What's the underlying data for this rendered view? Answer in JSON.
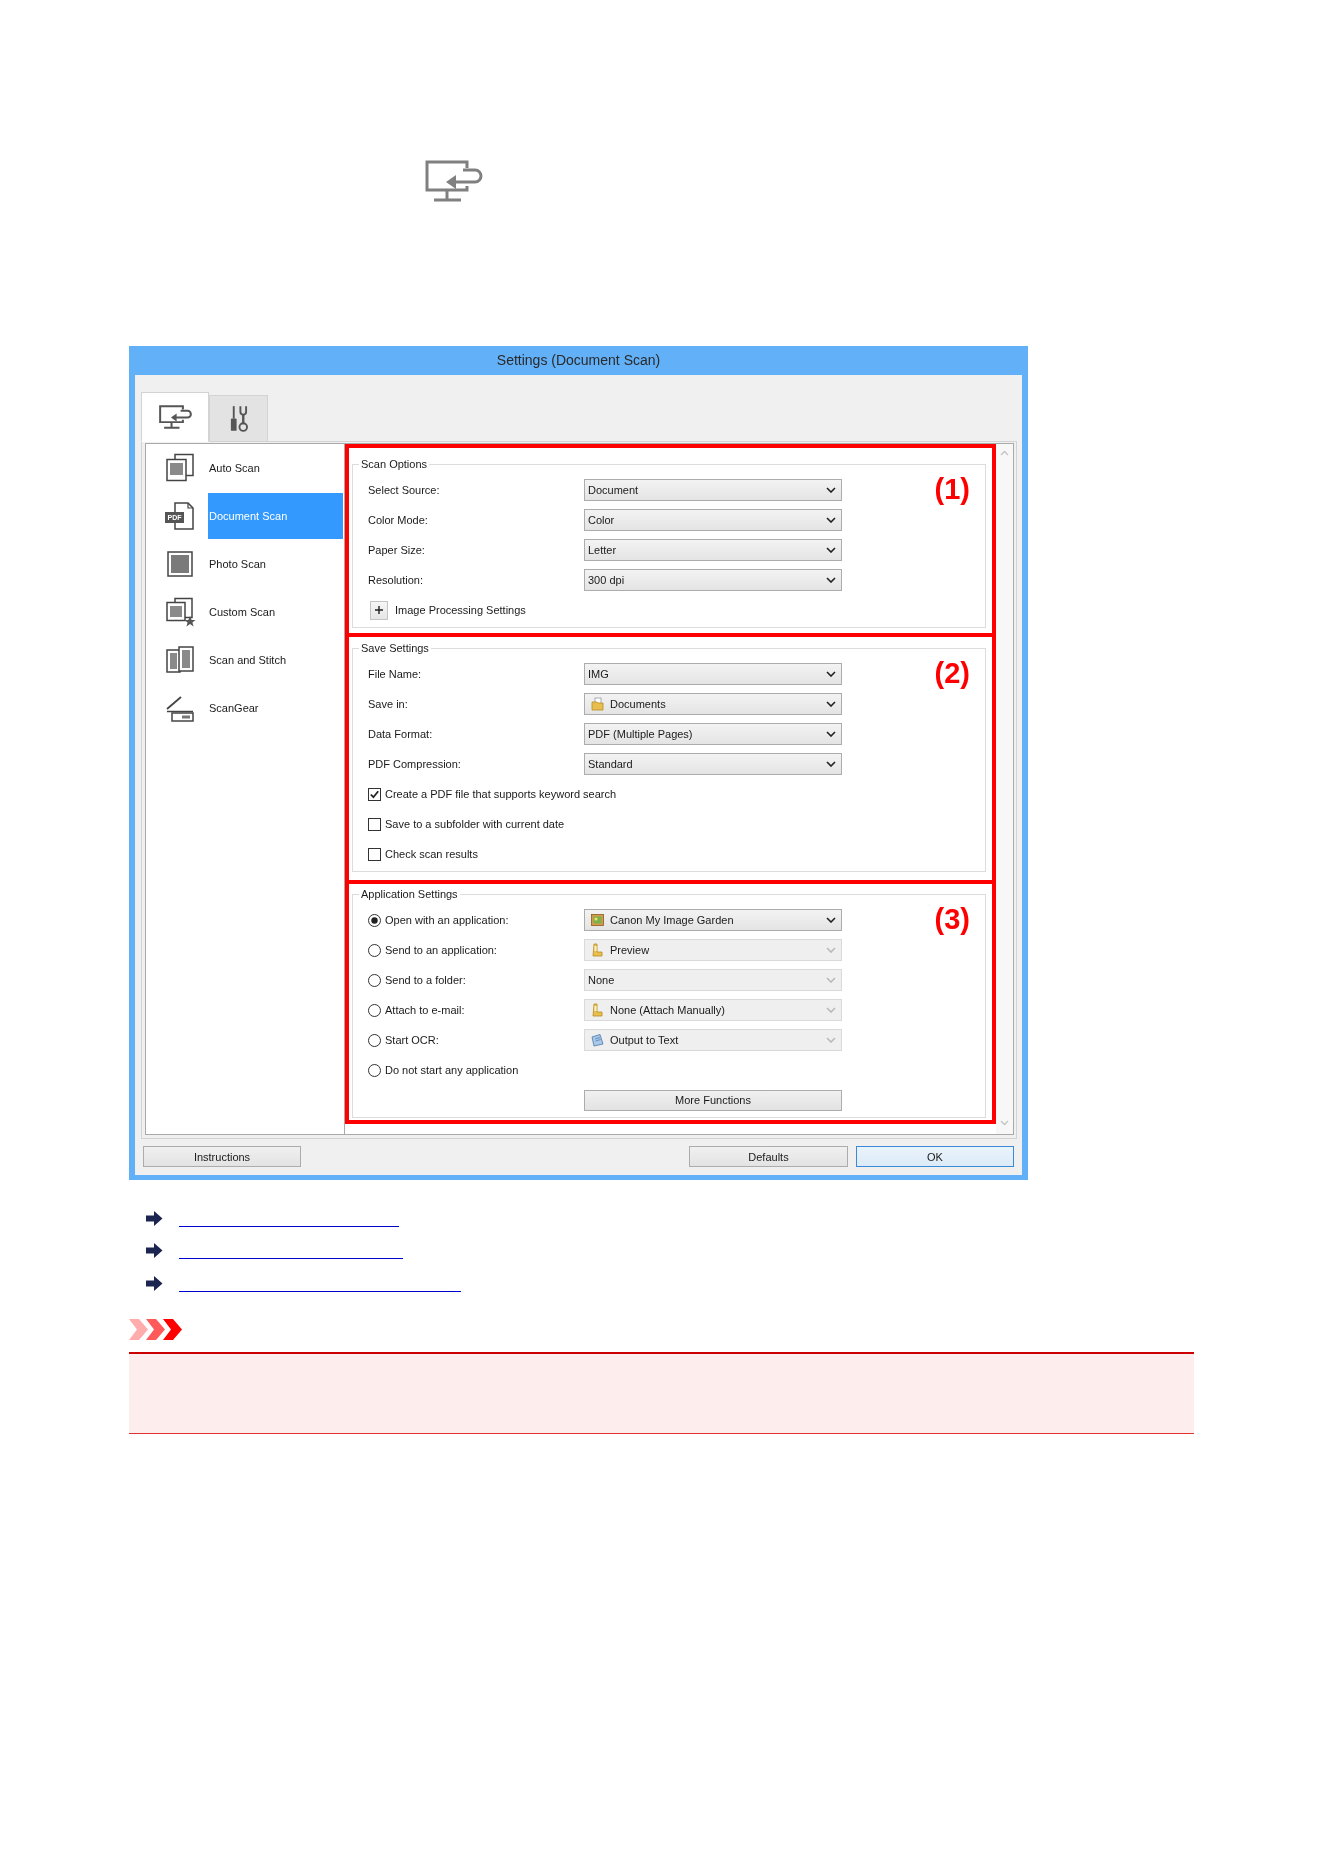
{
  "window": {
    "title": "Settings (Document Scan)"
  },
  "tabs": [
    {
      "selected": true
    },
    {
      "selected": false
    }
  ],
  "sidebar": {
    "items": [
      {
        "label": "Auto Scan",
        "selected": false
      },
      {
        "label": "Document Scan",
        "selected": true,
        "badge": "PDF"
      },
      {
        "label": "Photo Scan",
        "selected": false
      },
      {
        "label": "Custom Scan",
        "selected": false
      },
      {
        "label": "Scan and Stitch",
        "selected": false
      },
      {
        "label": "ScanGear",
        "selected": false
      }
    ]
  },
  "sections": [
    {
      "title": "Scan Options",
      "callout": "(1)",
      "rows": [
        {
          "kind": "dropdown",
          "label": "Select Source:",
          "value": "Document",
          "disabled": false
        },
        {
          "kind": "dropdown",
          "label": "Color Mode:",
          "value": "Color",
          "disabled": false
        },
        {
          "kind": "dropdown",
          "label": "Paper Size:",
          "value": "Letter",
          "disabled": false
        },
        {
          "kind": "dropdown",
          "label": "Resolution:",
          "value": "300 dpi",
          "disabled": false
        },
        {
          "kind": "expander",
          "label": "Image Processing Settings",
          "expanded": false
        }
      ]
    },
    {
      "title": "Save Settings",
      "callout": "(2)",
      "rows": [
        {
          "kind": "dropdown",
          "label": "File Name:",
          "value": "IMG",
          "disabled": false
        },
        {
          "kind": "dropdown",
          "label": "Save in:",
          "value": "Documents",
          "disabled": false
        },
        {
          "kind": "dropdown",
          "label": "Data Format:",
          "value": "PDF (Multiple Pages)",
          "disabled": false
        },
        {
          "kind": "dropdown",
          "label": "PDF Compression:",
          "value": "Standard",
          "disabled": false
        },
        {
          "kind": "checkbox",
          "label": "Create a PDF file that supports keyword search",
          "checked": true
        },
        {
          "kind": "checkbox",
          "label": "Save to a subfolder with current date",
          "checked": false
        },
        {
          "kind": "checkbox",
          "label": "Check scan results",
          "checked": false
        }
      ]
    },
    {
      "title": "Application Settings",
      "callout": "(3)",
      "rows": [
        {
          "kind": "radio",
          "label": "Open with an application:",
          "selected": true,
          "dropdown": {
            "value": "Canon My Image Garden",
            "disabled": false
          }
        },
        {
          "kind": "radio",
          "label": "Send to an application:",
          "selected": false,
          "dropdown": {
            "value": "Preview",
            "disabled": true
          }
        },
        {
          "kind": "radio",
          "label": "Send to a folder:",
          "selected": false,
          "dropdown": {
            "value": "None",
            "disabled": true
          }
        },
        {
          "kind": "radio",
          "label": "Attach to e-mail:",
          "selected": false,
          "dropdown": {
            "value": "None (Attach Manually)",
            "disabled": true
          }
        },
        {
          "kind": "radio",
          "label": "Start OCR:",
          "selected": false,
          "dropdown": {
            "value": "Output to Text",
            "disabled": true
          }
        },
        {
          "kind": "radio",
          "label": "Do not start any application",
          "selected": false
        },
        {
          "kind": "button",
          "label": "More Functions"
        }
      ]
    }
  ],
  "buttons": [
    {
      "label": "Instructions",
      "default": false
    },
    {
      "label": "Defaults",
      "default": false
    },
    {
      "label": "OK",
      "default": true
    }
  ],
  "links": [
    {
      "kind": "link"
    },
    {
      "kind": "link"
    },
    {
      "kind": "link"
    }
  ],
  "important_note": {
    "kind": "important"
  }
}
